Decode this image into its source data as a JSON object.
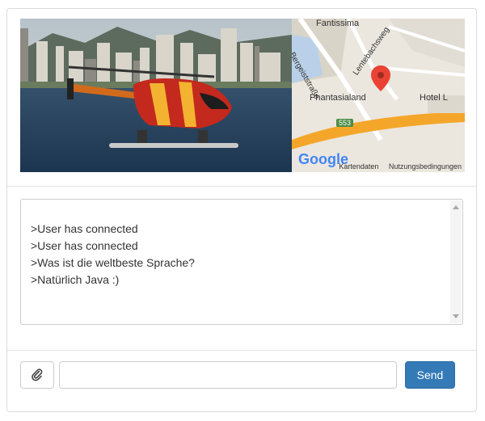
{
  "map": {
    "labels": {
      "place_top": "Fantissima",
      "street_1": "Bergeiststraße",
      "street_2": "Lentebachsweg",
      "poi_main": "Phantasialand",
      "poi_hotel": "Hotel L",
      "road_number": "553"
    },
    "logo": "Google",
    "footer": {
      "map_data": "Kartendaten",
      "terms": "Nutzungsbedingungen"
    }
  },
  "chat": {
    "lines": [
      ">User has connected",
      ">User has connected",
      ">Was ist die weltbeste Sprache?",
      ">Natürlich Java :)"
    ]
  },
  "composer": {
    "message_value": "",
    "send_label": "Send",
    "attach_icon": "paperclip-icon"
  },
  "colors": {
    "send_button": "#337ab7",
    "map_road": "#f4a62a",
    "map_pin": "#ea4335"
  }
}
